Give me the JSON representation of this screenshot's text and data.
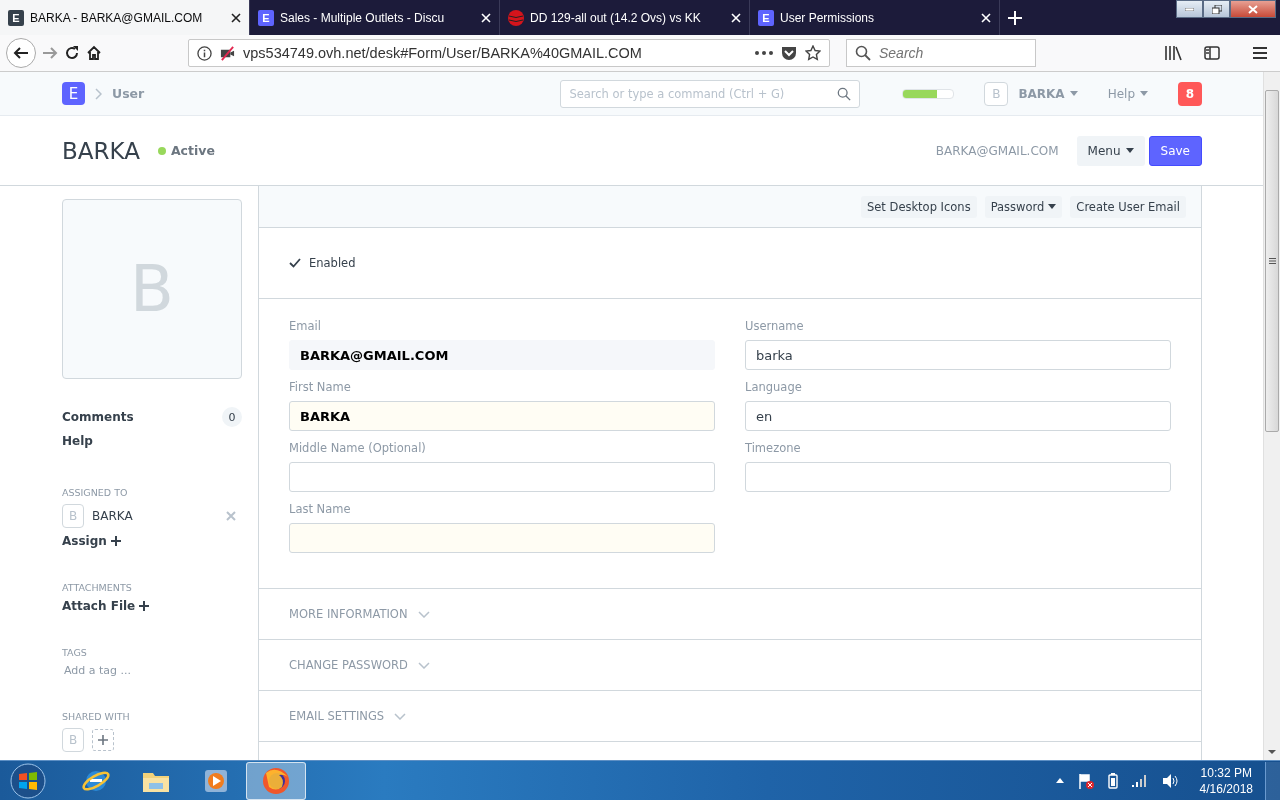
{
  "browser": {
    "tabs": [
      {
        "title": "BARKA - BARKA@GMAIL.COM",
        "selected": true,
        "icon": {
          "kind": "letter",
          "text": "E",
          "color": "#36414c"
        }
      },
      {
        "title": "Sales - Multiple Outlets - Discu",
        "selected": false,
        "icon": {
          "kind": "letter",
          "text": "E",
          "color": "#5e64ff"
        }
      },
      {
        "title": "DD 129-all out (14.2 Ovs) vs KK",
        "selected": false,
        "icon": {
          "kind": "ball",
          "color": "#d4141c"
        }
      },
      {
        "title": "User Permissions",
        "selected": false,
        "icon": {
          "kind": "letter",
          "text": "E",
          "color": "#5e64ff"
        }
      }
    ],
    "url": "vps534749.ovh.net/desk#Form/User/BARKA%40GMAIL.COM",
    "search": {
      "placeholder": "Search"
    }
  },
  "appbar": {
    "logo": "E",
    "breadcrumb": "User",
    "command": {
      "placeholder": "Search or type a command (Ctrl + G)"
    },
    "progress": {
      "level": 0.68
    },
    "avatar": "B",
    "user": "BARKA",
    "help": "Help",
    "notifications": "8"
  },
  "header": {
    "title": "BARKA",
    "status": {
      "label": "Active",
      "color": "#98d85b"
    },
    "email": "BARKA@GMAIL.COM",
    "buttons": [
      {
        "label": "Menu",
        "kind": "dropdown"
      },
      {
        "label": "Save",
        "kind": "primary"
      }
    ]
  },
  "sidebar": {
    "avatar": "B",
    "links": [
      {
        "label": "Comments",
        "count": "0"
      },
      {
        "label": "Help"
      }
    ],
    "assigned": {
      "heading": "ASSIGNED TO",
      "people": [
        {
          "avatar": "B",
          "name": "BARKA"
        }
      ],
      "action": "Assign"
    },
    "attachments": {
      "heading": "ATTACHMENTS",
      "action": "Attach File"
    },
    "tags": {
      "heading": "TAGS",
      "placeholder": "Add a tag ..."
    },
    "shared": {
      "heading": "SHARED WITH",
      "people": [
        {
          "avatar": "B"
        }
      ]
    }
  },
  "form": {
    "toolbar": [
      {
        "label": "Set Desktop Icons",
        "kind": "plain"
      },
      {
        "label": "Password",
        "kind": "dropdown"
      },
      {
        "label": "Create User Email",
        "kind": "plain"
      }
    ],
    "checkbox": {
      "label": "Enabled",
      "checked": true
    },
    "columns": [
      [
        {
          "label": "Email",
          "value": "BARKA@GMAIL.COM",
          "kind": "readonly",
          "bold": true
        },
        {
          "label": "First Name",
          "value": "BARKA",
          "kind": "mandatory",
          "bold": true
        },
        {
          "label": "Middle Name (Optional)",
          "kind": "plain"
        },
        {
          "label": "Last Name",
          "kind": "mandatory"
        }
      ],
      [
        {
          "label": "Username",
          "value": "barka",
          "kind": "plain",
          "bold": false
        },
        {
          "label": "Language",
          "value": "en",
          "kind": "plain",
          "bold": false
        },
        {
          "label": "Timezone",
          "kind": "plain"
        }
      ]
    ],
    "sections": [
      {
        "label": "MORE INFORMATION",
        "expanded": false
      },
      {
        "label": "CHANGE PASSWORD",
        "expanded": false
      },
      {
        "label": "EMAIL SETTINGS",
        "expanded": false
      }
    ]
  },
  "taskbar": {
    "apps": [
      {
        "kind": "ie",
        "selected": false
      },
      {
        "kind": "folder",
        "selected": false
      },
      {
        "kind": "media",
        "selected": false
      },
      {
        "kind": "firefox",
        "selected": true
      }
    ],
    "time": "10:32 PM",
    "date": "4/16/2018"
  }
}
